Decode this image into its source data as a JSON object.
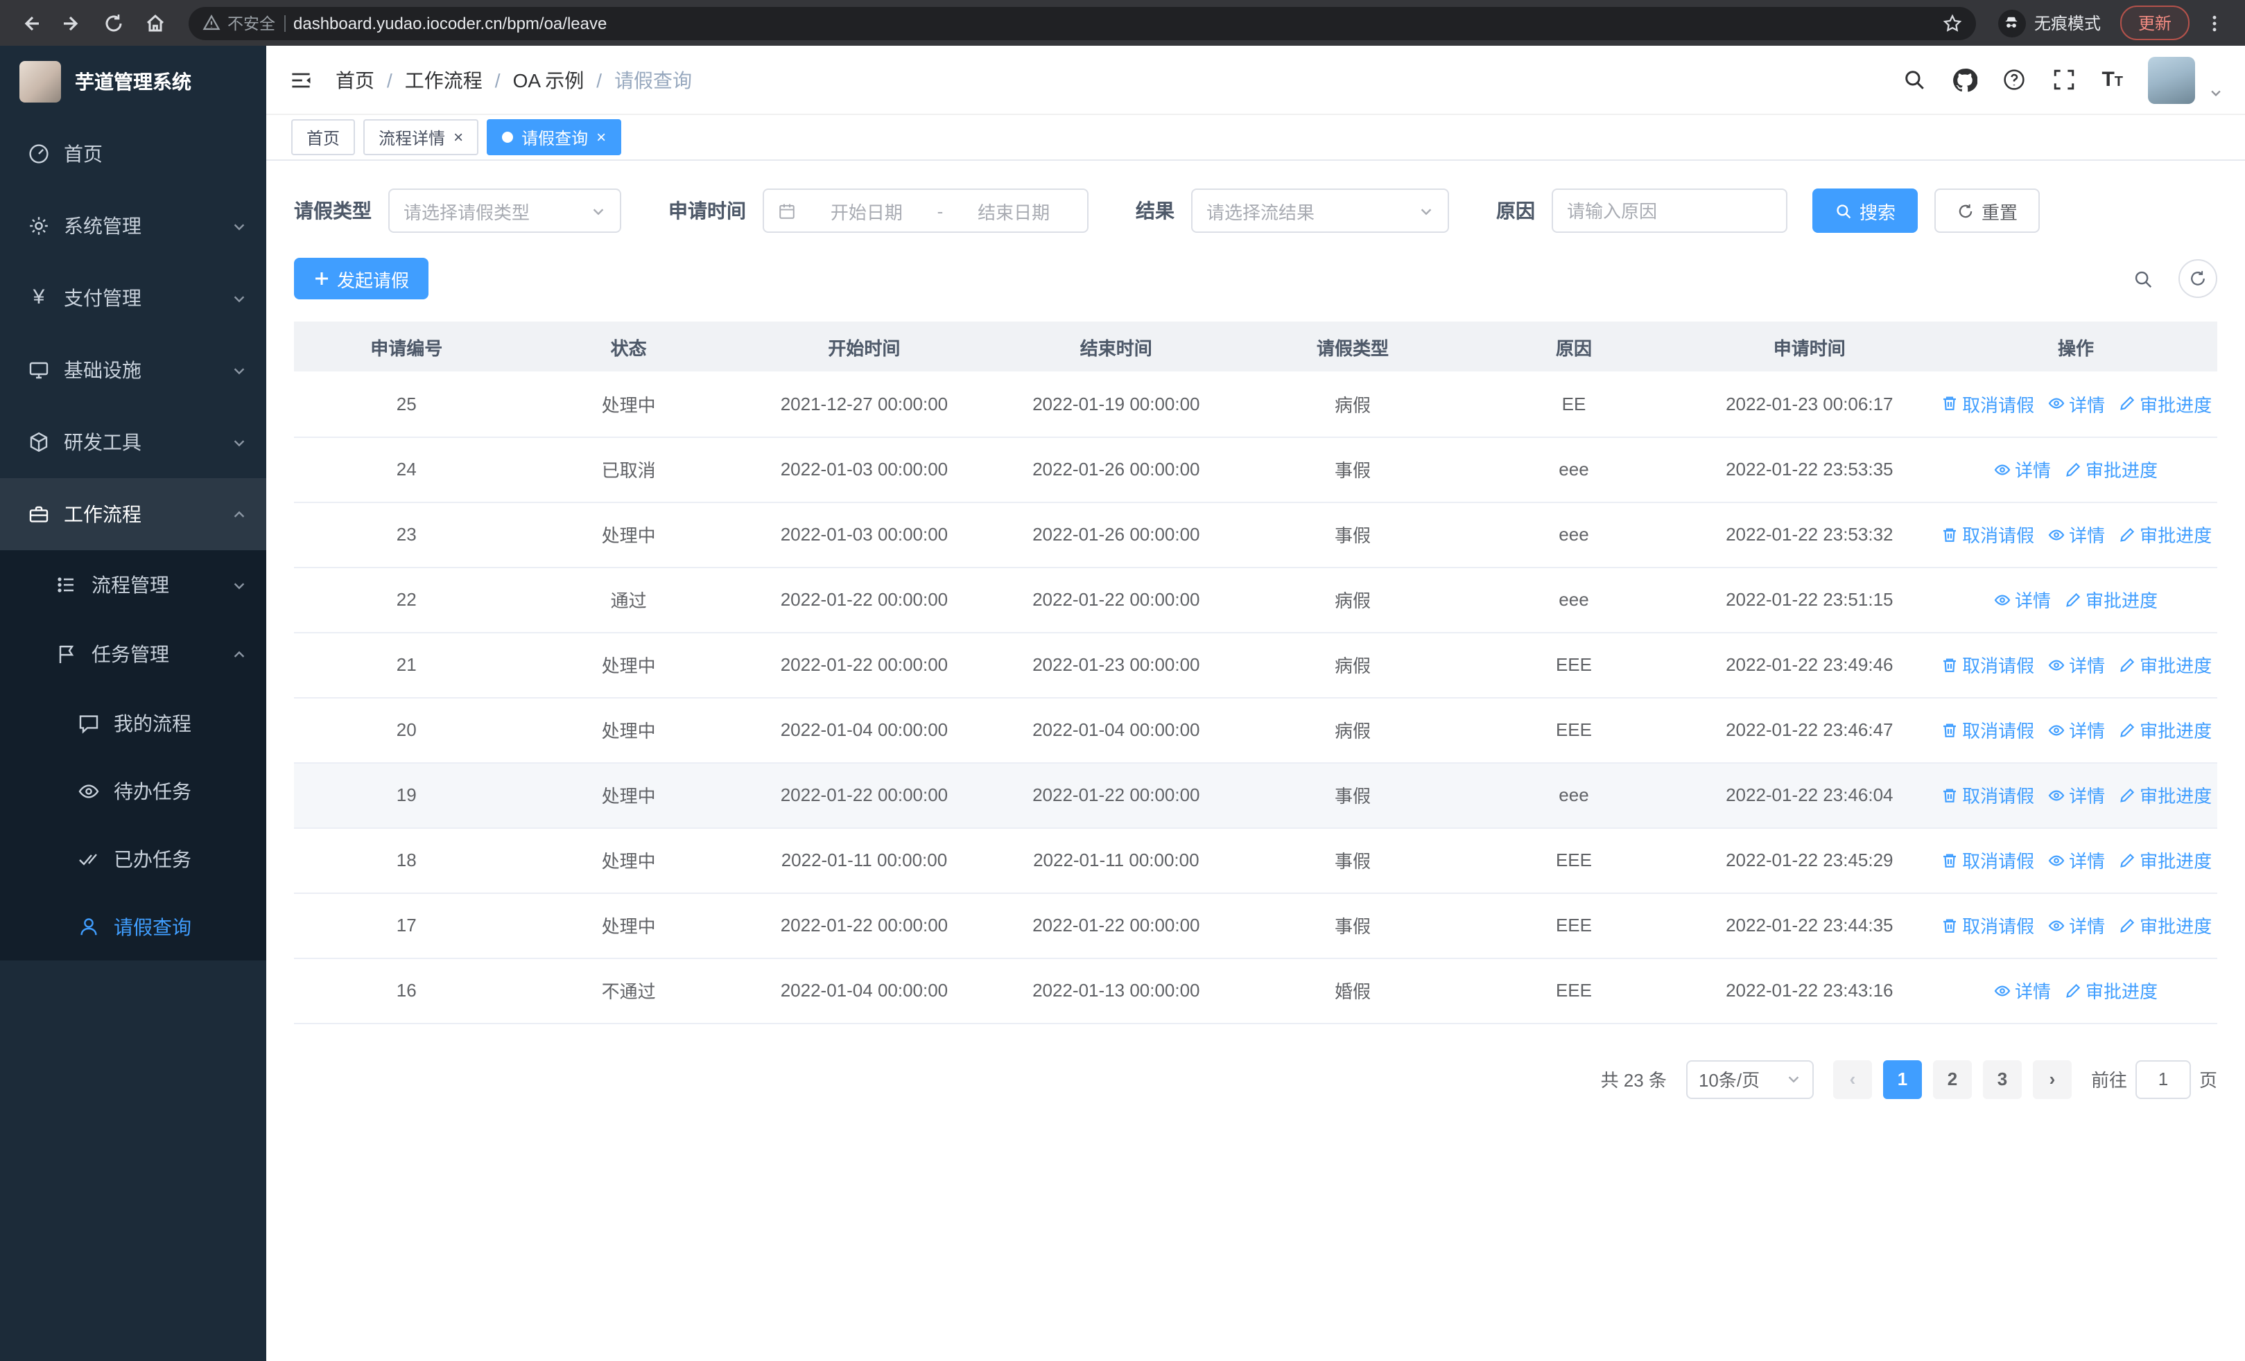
{
  "browser": {
    "security_label": "不安全",
    "url": "dashboard.yudao.iocoder.cn/bpm/oa/leave",
    "incognito_label": "无痕模式",
    "update_label": "更新"
  },
  "sidebar": {
    "logo_title": "芋道管理系统",
    "items": [
      {
        "label": "首页"
      },
      {
        "label": "系统管理"
      },
      {
        "label": "支付管理"
      },
      {
        "label": "基础设施"
      },
      {
        "label": "研发工具"
      },
      {
        "label": "工作流程"
      }
    ],
    "submenu": {
      "process": "流程管理",
      "task": "任务管理",
      "task_children": [
        "我的流程",
        "待办任务",
        "已办任务",
        "请假查询"
      ]
    }
  },
  "header": {
    "breadcrumb": [
      "首页",
      "工作流程",
      "OA 示例",
      "请假查询"
    ]
  },
  "tags": [
    {
      "label": "首页"
    },
    {
      "label": "流程详情"
    },
    {
      "label": "请假查询"
    }
  ],
  "filters": {
    "leave_type_label": "请假类型",
    "leave_type_placeholder": "请选择请假类型",
    "apply_time_label": "申请时间",
    "start_date_placeholder": "开始日期",
    "range_separator": "-",
    "end_date_placeholder": "结束日期",
    "result_label": "结果",
    "result_placeholder": "请选择流结果",
    "reason_label": "原因",
    "reason_placeholder": "请输入原因",
    "search_label": "搜索",
    "reset_label": "重置"
  },
  "toolbar": {
    "create_label": "发起请假"
  },
  "table": {
    "headers": [
      "申请编号",
      "状态",
      "开始时间",
      "结束时间",
      "请假类型",
      "原因",
      "申请时间",
      "操作"
    ],
    "actions": {
      "cancel": "取消请假",
      "detail": "详情",
      "progress": "审批进度"
    },
    "rows": [
      {
        "id": "25",
        "status": "处理中",
        "start": "2021-12-27 00:00:00",
        "end": "2022-01-19 00:00:00",
        "type": "病假",
        "reason": "EE",
        "applied": "2022-01-23 00:06:17",
        "cancellable": true,
        "highlighted": false
      },
      {
        "id": "24",
        "status": "已取消",
        "start": "2022-01-03 00:00:00",
        "end": "2022-01-26 00:00:00",
        "type": "事假",
        "reason": "eee",
        "applied": "2022-01-22 23:53:35",
        "cancellable": false,
        "highlighted": false
      },
      {
        "id": "23",
        "status": "处理中",
        "start": "2022-01-03 00:00:00",
        "end": "2022-01-26 00:00:00",
        "type": "事假",
        "reason": "eee",
        "applied": "2022-01-22 23:53:32",
        "cancellable": true,
        "highlighted": false
      },
      {
        "id": "22",
        "status": "通过",
        "start": "2022-01-22 00:00:00",
        "end": "2022-01-22 00:00:00",
        "type": "病假",
        "reason": "eee",
        "applied": "2022-01-22 23:51:15",
        "cancellable": false,
        "highlighted": false
      },
      {
        "id": "21",
        "status": "处理中",
        "start": "2022-01-22 00:00:00",
        "end": "2022-01-23 00:00:00",
        "type": "病假",
        "reason": "EEE",
        "applied": "2022-01-22 23:49:46",
        "cancellable": true,
        "highlighted": false
      },
      {
        "id": "20",
        "status": "处理中",
        "start": "2022-01-04 00:00:00",
        "end": "2022-01-04 00:00:00",
        "type": "病假",
        "reason": "EEE",
        "applied": "2022-01-22 23:46:47",
        "cancellable": true,
        "highlighted": false
      },
      {
        "id": "19",
        "status": "处理中",
        "start": "2022-01-22 00:00:00",
        "end": "2022-01-22 00:00:00",
        "type": "事假",
        "reason": "eee",
        "applied": "2022-01-22 23:46:04",
        "cancellable": true,
        "highlighted": true
      },
      {
        "id": "18",
        "status": "处理中",
        "start": "2022-01-11 00:00:00",
        "end": "2022-01-11 00:00:00",
        "type": "事假",
        "reason": "EEE",
        "applied": "2022-01-22 23:45:29",
        "cancellable": true,
        "highlighted": false
      },
      {
        "id": "17",
        "status": "处理中",
        "start": "2022-01-22 00:00:00",
        "end": "2022-01-22 00:00:00",
        "type": "事假",
        "reason": "EEE",
        "applied": "2022-01-22 23:44:35",
        "cancellable": true,
        "highlighted": false
      },
      {
        "id": "16",
        "status": "不通过",
        "start": "2022-01-04 00:00:00",
        "end": "2022-01-13 00:00:00",
        "type": "婚假",
        "reason": "EEE",
        "applied": "2022-01-22 23:43:16",
        "cancellable": false,
        "highlighted": false
      }
    ]
  },
  "pagination": {
    "total_text": "共 23 条",
    "page_size": "10条/页",
    "prev_label": "‹",
    "pages": [
      "1",
      "2",
      "3"
    ],
    "active_page": "1",
    "next_label": "›",
    "goto_label": "前往",
    "goto_value": "1",
    "page_unit": "页"
  },
  "colors": {
    "primary": "#409eff",
    "sidebar_bg": "#1c2b39",
    "header_bg": "#f0f2f5"
  }
}
